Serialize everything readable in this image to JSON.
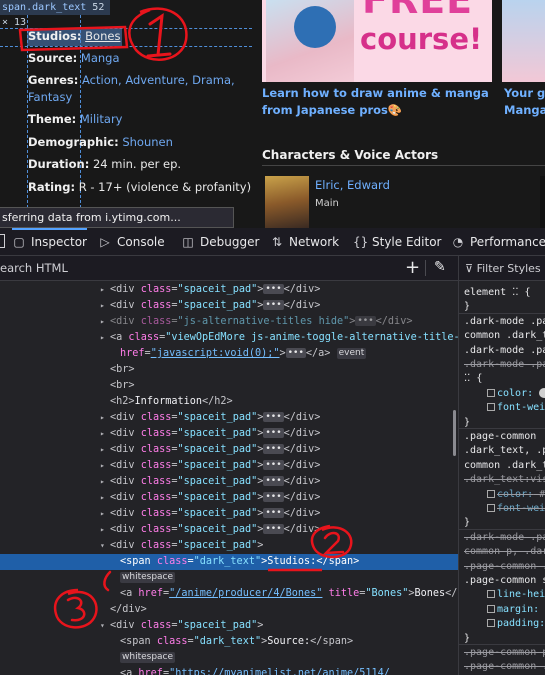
{
  "viewport": {
    "tooltip": {
      "tag": "span.dark_text",
      "size": "52 × 13"
    },
    "info_rows": [
      {
        "label": "Studios:",
        "value": "Bones"
      },
      {
        "label": "Source:",
        "value": "Manga"
      },
      {
        "label": "Genres:",
        "value": "Action, Adventure, Drama,",
        "value_cont": "Fantasy"
      },
      {
        "label": "Theme:",
        "value": "Military"
      },
      {
        "label": "Demographic:",
        "value": "Shounen"
      },
      {
        "label": "Duration:",
        "value": "24 min. per ep."
      },
      {
        "label": "Rating:",
        "value": "R - 17+ (violence & profanity)"
      }
    ],
    "promo": {
      "image_text_1": "FREE",
      "image_text_2": "course!",
      "title_line1": "Learn how to draw anime & manga",
      "title_line2": "from Japanese pros🎨",
      "title2_line1": "Your g",
      "title2_line2": "Manga"
    },
    "characters_heading": "Characters & Voice Actors",
    "character": {
      "name": "Elric, Edward",
      "role": "Main"
    },
    "status_text": "sferring data from i.ytimg.com..."
  },
  "devtools": {
    "tabs": [
      {
        "label": "Inspector",
        "icon": "inspector-icon",
        "glyph": "▢",
        "active": true
      },
      {
        "label": "Console",
        "icon": "console-icon",
        "glyph": "▷"
      },
      {
        "label": "Debugger",
        "icon": "debugger-icon",
        "glyph": "◫"
      },
      {
        "label": "Network",
        "icon": "network-icon",
        "glyph": "⇅"
      },
      {
        "label": "Style Editor",
        "icon": "style-editor-icon",
        "glyph": "{}"
      },
      {
        "label": "Performance",
        "icon": "performance-icon",
        "glyph": "◔"
      }
    ],
    "search_placeholder": "earch HTML",
    "filter_styles": "Filter Styles"
  },
  "tree": {
    "lines": [
      {
        "indent": 1,
        "tw": "▸",
        "html": "div_sp_collapsed"
      },
      {
        "indent": 1,
        "tw": "▸",
        "html": "div_sp_collapsed"
      },
      {
        "indent": 1,
        "tw": "▸",
        "html": "div_alt_titles"
      },
      {
        "indent": 1,
        "tw": "▸",
        "html": "a_viewop"
      },
      {
        "indent": 2,
        "tw": "",
        "html": "a_href_cont"
      },
      {
        "indent": 1,
        "tw": "",
        "html": "br"
      },
      {
        "indent": 1,
        "tw": "",
        "html": "br"
      },
      {
        "indent": 1,
        "tw": "",
        "html": "h2"
      },
      {
        "indent": 1,
        "tw": "▸",
        "html": "div_sp_collapsed"
      },
      {
        "indent": 1,
        "tw": "▸",
        "html": "div_sp_collapsed"
      },
      {
        "indent": 1,
        "tw": "▸",
        "html": "div_sp_collapsed"
      },
      {
        "indent": 1,
        "tw": "▸",
        "html": "div_sp_collapsed"
      },
      {
        "indent": 1,
        "tw": "▸",
        "html": "div_sp_collapsed"
      },
      {
        "indent": 1,
        "tw": "▸",
        "html": "div_sp_collapsed"
      },
      {
        "indent": 1,
        "tw": "▸",
        "html": "div_sp_collapsed"
      },
      {
        "indent": 1,
        "tw": "▸",
        "html": "div_sp_collapsed"
      },
      {
        "indent": 1,
        "tw": "▾",
        "html": "div_sp_open"
      },
      {
        "indent": 2,
        "tw": "",
        "html": "span_studios",
        "selected": true
      },
      {
        "indent": 2,
        "tw": "",
        "html": "whitespace"
      },
      {
        "indent": 2,
        "tw": "",
        "html": "a_bones"
      },
      {
        "indent": 1,
        "tw": "",
        "html": "div_close"
      },
      {
        "indent": 1,
        "tw": "▾",
        "html": "div_sp_open"
      },
      {
        "indent": 2,
        "tw": "",
        "html": "span_source"
      },
      {
        "indent": 2,
        "tw": "",
        "html": "whitespace"
      },
      {
        "indent": 2,
        "tw": "",
        "html": "a_source_href"
      }
    ],
    "strings": {
      "div": "div",
      "class_attr": "class",
      "spaceit_pad": "\"spaceit_pad\"",
      "js_alt": "\"js-alternative-titles hide\"",
      "viewop": "\"viewOpEdMore js-anime-toggle-alternative-title-b",
      "href_attr": "href",
      "void_href": "\"javascript:void(0);\"",
      "event_badge": "event",
      "br": "<br>",
      "h2_open": "<h2>",
      "h2_text": "Information",
      "h2_close": "</h2>",
      "dark_text": "\"dark_text\"",
      "studios_text": "Studios:",
      "source_text": "Source:",
      "whitespace_badge": "whitespace",
      "producer_href": "\"/anime/producer/4/Bones\"",
      "title_attr": "title",
      "bones_title": "\"Bones\"",
      "bones_text": "Bones",
      "source_href": "\"https://myanimelist.net/anime/5114/",
      "dots": "•••"
    }
  },
  "rules": {
    "lines": [
      {
        "t": "element ⁚⁚ {",
        "k": "plain"
      },
      {
        "t": "}",
        "k": "plain"
      },
      {
        "t": ".dark-mode .pa",
        "k": "plain"
      },
      {
        "t": "common .dark_t",
        "k": "plain"
      },
      {
        "t": ".dark-mode .pa",
        "k": "plain"
      },
      {
        "t": ".dark-mode .pa",
        "k": "strike"
      },
      {
        "t": "⁚⁚ {",
        "k": "plain"
      },
      {
        "t": "color:",
        "k": "prop",
        "swatch": true
      },
      {
        "t": "font-weig",
        "k": "prop"
      },
      {
        "t": "}",
        "k": "plain"
      },
      {
        "t": ".page-common",
        "k": "plain"
      },
      {
        "t": ".dark_text, .p",
        "k": "plain"
      },
      {
        "t": "common .dark_t",
        "k": "plain"
      },
      {
        "t": ".dark_text:vis",
        "k": "strike"
      },
      {
        "t": "color: #4",
        "k": "prop-strike"
      },
      {
        "t": "font-weig",
        "k": "prop-strike"
      },
      {
        "t": "}",
        "k": "plain"
      },
      {
        "t": ".dark-mode .pa",
        "k": "strike"
      },
      {
        "t": "common p, .dar",
        "k": "strike"
      },
      {
        "t": ".page-common .",
        "k": "strike"
      },
      {
        "t": ".page-common s",
        "k": "plain"
      },
      {
        "t": "line-heig",
        "k": "prop"
      },
      {
        "t": "margin: ▸",
        "k": "prop"
      },
      {
        "t": "padding: ▸",
        "k": "prop"
      },
      {
        "t": "}",
        "k": "plain"
      },
      {
        "t": ".page-common p",
        "k": "strike"
      },
      {
        "t": ".page-common .",
        "k": "strike"
      },
      {
        "t": ".textReadabili",
        "k": "strike"
      }
    ]
  },
  "annotations": {
    "colors": {
      "ink": "#e8141c"
    },
    "labels": [
      "1",
      "2",
      "3"
    ]
  }
}
